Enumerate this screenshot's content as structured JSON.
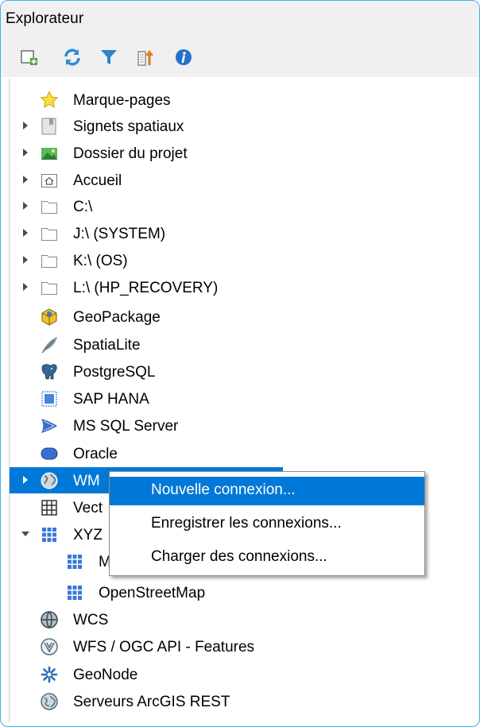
{
  "panel": {
    "title": "Explorateur"
  },
  "toolbar": {
    "buttons": [
      {
        "icon": "add-layer-icon"
      },
      {
        "icon": "refresh-icon"
      },
      {
        "icon": "filter-icon"
      },
      {
        "icon": "collapse-all-icon"
      },
      {
        "icon": "info-icon"
      }
    ]
  },
  "tree": [
    {
      "label": "Marque-pages",
      "icon": "star-icon",
      "expander": "none"
    },
    {
      "label": "Signets spatiaux",
      "icon": "bookmark-icon",
      "expander": "collapsed"
    },
    {
      "label": "Dossier du projet",
      "icon": "project-folder-icon",
      "expander": "collapsed"
    },
    {
      "label": "Accueil",
      "icon": "home-folder-icon",
      "expander": "collapsed"
    },
    {
      "label": "C:\\",
      "icon": "drive-icon",
      "expander": "collapsed"
    },
    {
      "label": "J:\\ (SYSTEM)",
      "icon": "drive-icon",
      "expander": "collapsed"
    },
    {
      "label": "K:\\ (OS)",
      "icon": "drive-icon",
      "expander": "collapsed"
    },
    {
      "label": "L:\\ (HP_RECOVERY)",
      "icon": "drive-icon",
      "expander": "collapsed"
    },
    {
      "label": "GeoPackage",
      "icon": "geopackage-icon",
      "expander": "none"
    },
    {
      "label": "SpatiaLite",
      "icon": "spatialite-feather-icon",
      "expander": "none"
    },
    {
      "label": "PostgreSQL",
      "icon": "postgresql-elephant-icon",
      "expander": "none"
    },
    {
      "label": "SAP HANA",
      "icon": "sap-hana-icon",
      "expander": "none"
    },
    {
      "label": "MS SQL Server",
      "icon": "mssql-icon",
      "expander": "none"
    },
    {
      "label": "Oracle",
      "icon": "oracle-icon",
      "expander": "none"
    },
    {
      "label": "WMS/WMTS",
      "visible_label": "WM",
      "icon": "globe-icon",
      "expander": "collapsed",
      "selected": true
    },
    {
      "label": "Vector Tiles",
      "visible_label": "Vect",
      "icon": "vector-tiles-icon",
      "expander": "none"
    },
    {
      "label": "XYZ Tiles",
      "visible_label": "XYZ",
      "icon": "xyz-grid-icon",
      "expander": "expanded"
    },
    {
      "label": "Mapzen Global Terrain",
      "visible_label": "M",
      "icon": "xyz-grid-icon",
      "expander": "none",
      "indent": 1
    },
    {
      "label": "OpenStreetMap",
      "icon": "xyz-grid-icon",
      "expander": "none",
      "indent": 1
    },
    {
      "label": "WCS",
      "icon": "wcs-globe-icon",
      "expander": "none"
    },
    {
      "label": "WFS / OGC API - Features",
      "icon": "wfs-icon",
      "expander": "none"
    },
    {
      "label": "GeoNode",
      "icon": "geonode-icon",
      "expander": "none"
    },
    {
      "label": "Serveurs ArcGIS REST",
      "icon": "arcgis-icon",
      "expander": "none"
    }
  ],
  "context_menu": {
    "items": [
      {
        "label": "Nouvelle connexion...",
        "highlighted": true
      },
      {
        "label": "Enregistrer les connexions..."
      },
      {
        "label": "Charger des connexions..."
      }
    ]
  },
  "colors": {
    "selection": "#0078d7",
    "panel_border": "#35b6e6",
    "toolbar_bg": "#f0f0f0"
  }
}
